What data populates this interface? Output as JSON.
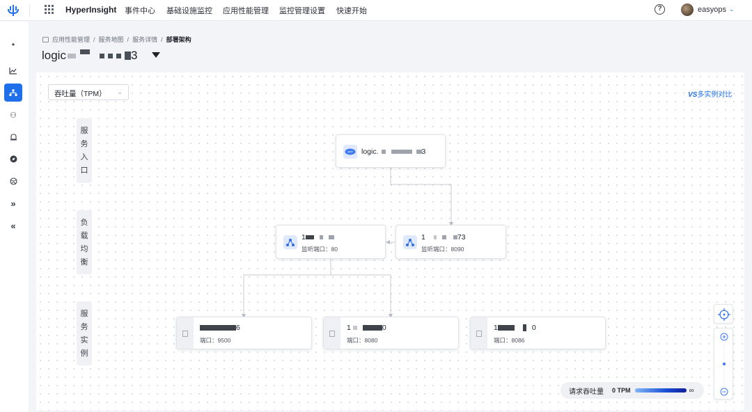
{
  "topbar": {
    "brand": "HyperInsight",
    "nav": [
      "事件中心",
      "基础设施监控",
      "应用性能管理",
      "监控管理设置",
      "快速开始"
    ],
    "user": "easyops"
  },
  "breadcrumb": [
    "应用性能管理",
    "服务地图",
    "服务详情",
    "部署架构"
  ],
  "page_title_prefix": "logic",
  "page_title_suffix": "3",
  "metric_select": "吞吐量（TPM）",
  "compare_link_vs": "VS",
  "compare_link": "多实例对比",
  "lanes": {
    "entry": "服务入口",
    "lb": "负载均衡",
    "instance": "服务实例"
  },
  "service_node": {
    "name_prefix": "logic.",
    "name_suffix": "3",
    "icon": "service-logo-icon"
  },
  "lb_nodes": [
    {
      "name_prefix": "1",
      "name_suffix": "",
      "port_label": "监听端口：80",
      "icon": "load-balancer-icon"
    },
    {
      "name_prefix": "1",
      "name_suffix": "73",
      "port_label": "监听端口：8090",
      "icon": "load-balancer-icon"
    }
  ],
  "instances": [
    {
      "name_prefix": "",
      "name_suffix": "6",
      "port_label": "端口：9500"
    },
    {
      "name_prefix": "1",
      "name_suffix": "0",
      "port_label": "端口：8080"
    },
    {
      "name_prefix": "1",
      "name_suffix": "0",
      "port_label": "端口：8086"
    }
  ],
  "legend": {
    "label": "请求吞吐量",
    "min": "0 TPM",
    "max": "∞"
  },
  "accent_color": "#1f6fea"
}
